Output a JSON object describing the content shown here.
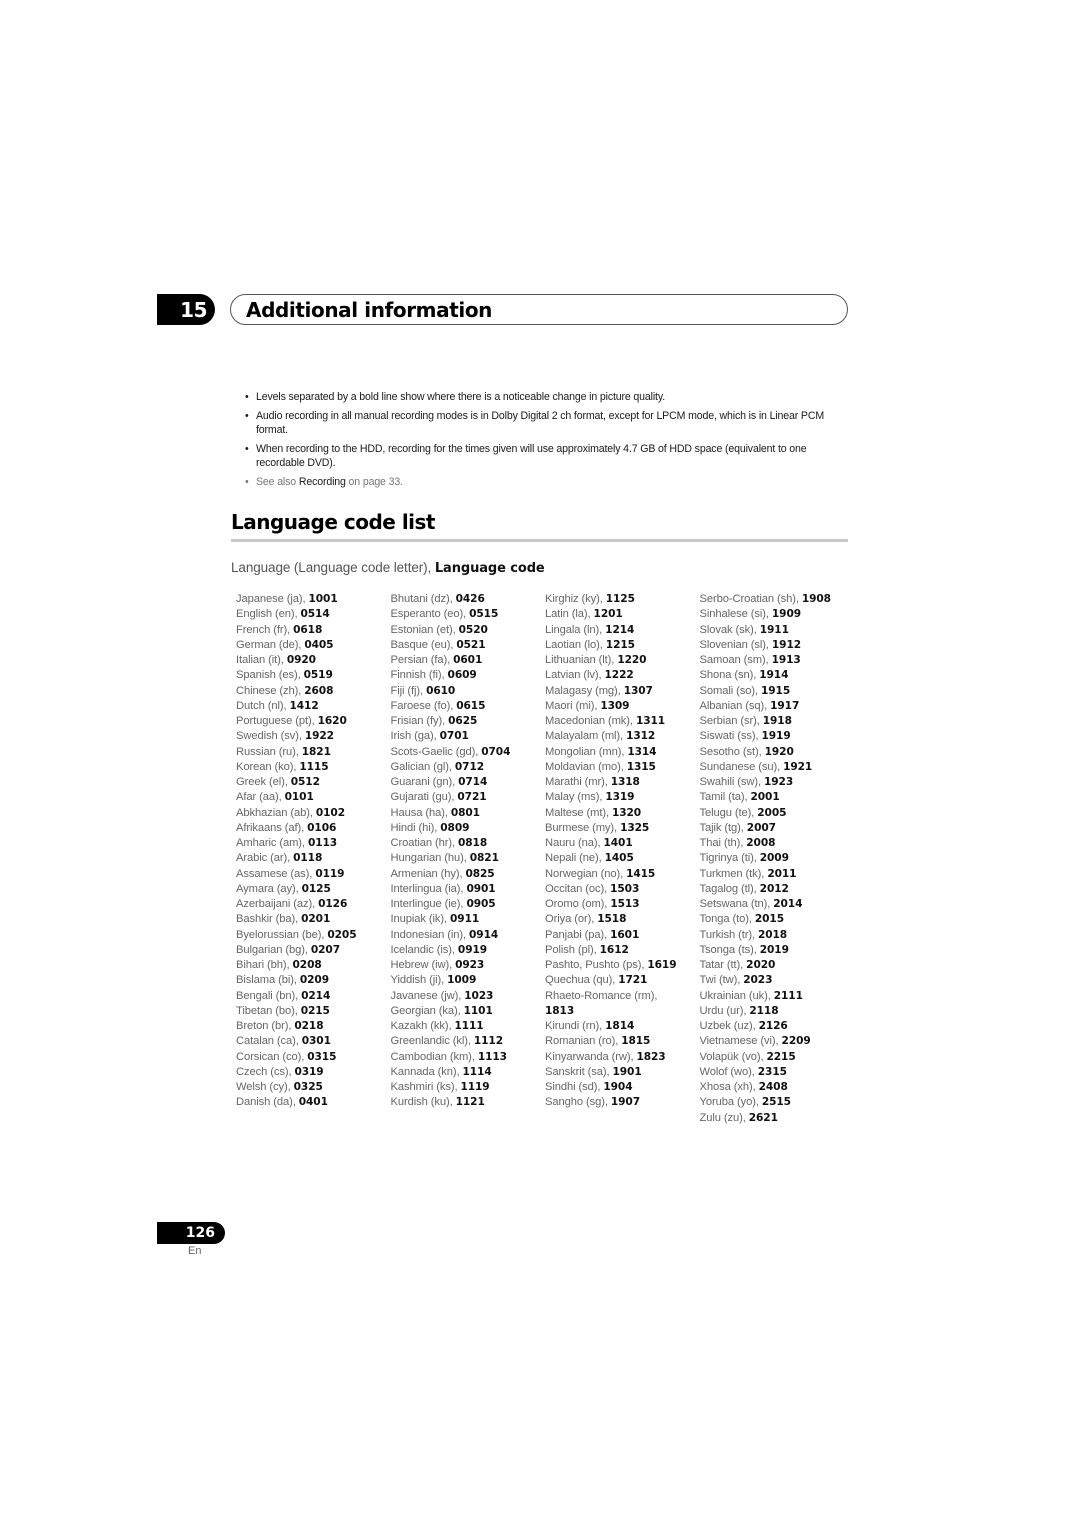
{
  "chapter": {
    "number": "15",
    "title": "Additional information"
  },
  "notes": [
    "Levels separated by a bold line show where there is a noticeable change in picture quality.",
    "Audio recording in all manual recording modes is in Dolby Digital 2 ch format, except for LPCM mode, which is in Linear PCM format.",
    "When recording to the HDD, recording for the times given will use approximately 4.7 GB of HDD space (equivalent to one recordable DVD)."
  ],
  "see_also": {
    "prefix": "See also ",
    "link": "Recording",
    "suffix": " on page 33."
  },
  "section": {
    "title": "Language code list",
    "legend_plain": "Language (Language code letter), ",
    "legend_bold": "Language code"
  },
  "columns": [
    [
      {
        "label": "Japanese (ja), ",
        "code": "1001"
      },
      {
        "label": "English (en), ",
        "code": "0514"
      },
      {
        "label": "French (fr), ",
        "code": "0618"
      },
      {
        "label": "German (de), ",
        "code": "0405"
      },
      {
        "label": "Italian (it), ",
        "code": "0920"
      },
      {
        "label": "Spanish (es), ",
        "code": "0519"
      },
      {
        "label": "Chinese (zh), ",
        "code": "2608"
      },
      {
        "label": "Dutch (nl), ",
        "code": "1412"
      },
      {
        "label": "Portuguese (pt), ",
        "code": "1620"
      },
      {
        "label": "Swedish (sv), ",
        "code": "1922"
      },
      {
        "label": "Russian (ru), ",
        "code": "1821"
      },
      {
        "label": "Korean (ko), ",
        "code": "1115"
      },
      {
        "label": "Greek (el), ",
        "code": "0512"
      },
      {
        "label": "Afar (aa), ",
        "code": "0101"
      },
      {
        "label": "Abkhazian (ab), ",
        "code": "0102"
      },
      {
        "label": "Afrikaans (af), ",
        "code": "0106"
      },
      {
        "label": "Amharic (am), ",
        "code": "0113"
      },
      {
        "label": "Arabic (ar), ",
        "code": "0118"
      },
      {
        "label": "Assamese (as), ",
        "code": "0119"
      },
      {
        "label": "Aymara (ay), ",
        "code": "0125"
      },
      {
        "label": "Azerbaijani (az), ",
        "code": "0126"
      },
      {
        "label": "Bashkir (ba), ",
        "code": "0201"
      },
      {
        "label": "Byelorussian (be), ",
        "code": "0205"
      },
      {
        "label": "Bulgarian (bg), ",
        "code": "0207"
      },
      {
        "label": "Bihari (bh), ",
        "code": "0208"
      },
      {
        "label": "Bislama (bi), ",
        "code": "0209"
      },
      {
        "label": "Bengali (bn), ",
        "code": "0214"
      },
      {
        "label": "Tibetan (bo), ",
        "code": "0215"
      },
      {
        "label": "Breton (br), ",
        "code": "0218"
      },
      {
        "label": "Catalan (ca), ",
        "code": "0301"
      },
      {
        "label": "Corsican (co), ",
        "code": "0315"
      },
      {
        "label": "Czech (cs), ",
        "code": "0319"
      },
      {
        "label": "Welsh (cy), ",
        "code": "0325"
      },
      {
        "label": "Danish (da), ",
        "code": "0401"
      }
    ],
    [
      {
        "label": "Bhutani (dz), ",
        "code": "0426"
      },
      {
        "label": "Esperanto (eo), ",
        "code": "0515"
      },
      {
        "label": "Estonian (et), ",
        "code": "0520"
      },
      {
        "label": "Basque (eu), ",
        "code": "0521"
      },
      {
        "label": "Persian (fa), ",
        "code": "0601"
      },
      {
        "label": "Finnish (fi), ",
        "code": "0609"
      },
      {
        "label": "Fiji (fj), ",
        "code": "0610"
      },
      {
        "label": "Faroese (fo), ",
        "code": "0615"
      },
      {
        "label": "Frisian (fy), ",
        "code": "0625"
      },
      {
        "label": "Irish (ga), ",
        "code": "0701"
      },
      {
        "label": "Scots-Gaelic (gd), ",
        "code": "0704"
      },
      {
        "label": "Galician (gl), ",
        "code": "0712"
      },
      {
        "label": "Guarani (gn), ",
        "code": "0714"
      },
      {
        "label": "Gujarati (gu), ",
        "code": "0721"
      },
      {
        "label": "Hausa (ha), ",
        "code": "0801"
      },
      {
        "label": "Hindi (hi), ",
        "code": "0809"
      },
      {
        "label": "Croatian (hr), ",
        "code": "0818"
      },
      {
        "label": "Hungarian (hu), ",
        "code": "0821"
      },
      {
        "label": "Armenian (hy), ",
        "code": "0825"
      },
      {
        "label": "Interlingua (ia), ",
        "code": "0901"
      },
      {
        "label": "Interlingue (ie), ",
        "code": "0905"
      },
      {
        "label": "Inupiak (ik), ",
        "code": "0911"
      },
      {
        "label": "Indonesian (in), ",
        "code": "0914"
      },
      {
        "label": "Icelandic (is), ",
        "code": "0919"
      },
      {
        "label": "Hebrew (iw), ",
        "code": "0923"
      },
      {
        "label": "Yiddish (ji), ",
        "code": "1009"
      },
      {
        "label": "Javanese (jw), ",
        "code": "1023"
      },
      {
        "label": "Georgian (ka), ",
        "code": "1101"
      },
      {
        "label": "Kazakh (kk), ",
        "code": "1111"
      },
      {
        "label": "Greenlandic (kl), ",
        "code": "1112"
      },
      {
        "label": "Cambodian (km), ",
        "code": "1113"
      },
      {
        "label": "Kannada (kn), ",
        "code": "1114"
      },
      {
        "label": "Kashmiri (ks), ",
        "code": "1119"
      },
      {
        "label": "Kurdish (ku), ",
        "code": "1121"
      }
    ],
    [
      {
        "label": "Kirghiz (ky), ",
        "code": "1125"
      },
      {
        "label": "Latin (la), ",
        "code": "1201"
      },
      {
        "label": "Lingala (ln), ",
        "code": "1214"
      },
      {
        "label": "Laotian (lo), ",
        "code": "1215"
      },
      {
        "label": "Lithuanian (lt), ",
        "code": "1220"
      },
      {
        "label": "Latvian (lv), ",
        "code": "1222"
      },
      {
        "label": "Malagasy (mg), ",
        "code": "1307"
      },
      {
        "label": "Maori (mi), ",
        "code": "1309"
      },
      {
        "label": "Macedonian (mk), ",
        "code": "1311"
      },
      {
        "label": "Malayalam (ml), ",
        "code": "1312"
      },
      {
        "label": "Mongolian (mn), ",
        "code": "1314"
      },
      {
        "label": "Moldavian (mo), ",
        "code": "1315"
      },
      {
        "label": "Marathi (mr), ",
        "code": "1318"
      },
      {
        "label": "Malay (ms), ",
        "code": "1319"
      },
      {
        "label": "Maltese (mt), ",
        "code": "1320"
      },
      {
        "label": "Burmese (my), ",
        "code": "1325"
      },
      {
        "label": "Nauru (na), ",
        "code": "1401"
      },
      {
        "label": "Nepali (ne), ",
        "code": "1405"
      },
      {
        "label": "Norwegian (no), ",
        "code": "1415"
      },
      {
        "label": "Occitan (oc), ",
        "code": "1503"
      },
      {
        "label": "Oromo (om), ",
        "code": "1513"
      },
      {
        "label": "Oriya (or), ",
        "code": "1518"
      },
      {
        "label": "Panjabi (pa), ",
        "code": "1601"
      },
      {
        "label": "Polish (pl), ",
        "code": "1612"
      },
      {
        "label": "Pashto, Pushto (ps), ",
        "code": "1619"
      },
      {
        "label": "Quechua (qu), ",
        "code": "1721"
      },
      {
        "label": "Rhaeto-Romance (rm), ",
        "code": "1813",
        "wrap": true
      },
      {
        "label": "Kirundi (rn), ",
        "code": "1814"
      },
      {
        "label": "Romanian (ro), ",
        "code": "1815"
      },
      {
        "label": "Kinyarwanda (rw), ",
        "code": "1823"
      },
      {
        "label": "Sanskrit (sa), ",
        "code": "1901"
      },
      {
        "label": "Sindhi (sd), ",
        "code": "1904"
      },
      {
        "label": "Sangho (sg), ",
        "code": "1907"
      }
    ],
    [
      {
        "label": "Serbo-Croatian (sh), ",
        "code": "1908"
      },
      {
        "label": "Sinhalese (si), ",
        "code": "1909"
      },
      {
        "label": "Slovak (sk), ",
        "code": "1911"
      },
      {
        "label": "Slovenian (sl), ",
        "code": "1912"
      },
      {
        "label": "Samoan (sm), ",
        "code": "1913"
      },
      {
        "label": "Shona (sn), ",
        "code": "1914"
      },
      {
        "label": "Somali (so), ",
        "code": "1915"
      },
      {
        "label": "Albanian (sq), ",
        "code": "1917"
      },
      {
        "label": "Serbian (sr), ",
        "code": "1918"
      },
      {
        "label": "Siswati (ss), ",
        "code": "1919"
      },
      {
        "label": "Sesotho (st), ",
        "code": "1920"
      },
      {
        "label": "Sundanese (su), ",
        "code": "1921"
      },
      {
        "label": "Swahili (sw), ",
        "code": "1923"
      },
      {
        "label": "Tamil (ta), ",
        "code": "2001"
      },
      {
        "label": "Telugu (te), ",
        "code": "2005"
      },
      {
        "label": "Tajik (tg), ",
        "code": "2007"
      },
      {
        "label": "Thai (th), ",
        "code": "2008"
      },
      {
        "label": "Tigrinya (ti), ",
        "code": "2009"
      },
      {
        "label": "Turkmen (tk), ",
        "code": "2011"
      },
      {
        "label": "Tagalog (tl), ",
        "code": "2012"
      },
      {
        "label": "Setswana (tn), ",
        "code": "2014"
      },
      {
        "label": "Tonga (to), ",
        "code": "2015"
      },
      {
        "label": "Turkish (tr), ",
        "code": "2018"
      },
      {
        "label": "Tsonga (ts), ",
        "code": "2019"
      },
      {
        "label": "Tatar (tt), ",
        "code": "2020"
      },
      {
        "label": "Twi (tw), ",
        "code": "2023"
      },
      {
        "label": "Ukrainian (uk), ",
        "code": "2111"
      },
      {
        "label": "Urdu (ur), ",
        "code": "2118"
      },
      {
        "label": "Uzbek (uz), ",
        "code": "2126"
      },
      {
        "label": "Vietnamese (vi), ",
        "code": "2209"
      },
      {
        "label": "Volapük (vo), ",
        "code": "2215"
      },
      {
        "label": "Wolof (wo), ",
        "code": "2315"
      },
      {
        "label": "Xhosa (xh), ",
        "code": "2408"
      },
      {
        "label": "Yoruba (yo), ",
        "code": "2515"
      },
      {
        "label": "Zulu (zu), ",
        "code": "2621"
      }
    ]
  ],
  "footer": {
    "page_number": "126",
    "language": "En"
  }
}
